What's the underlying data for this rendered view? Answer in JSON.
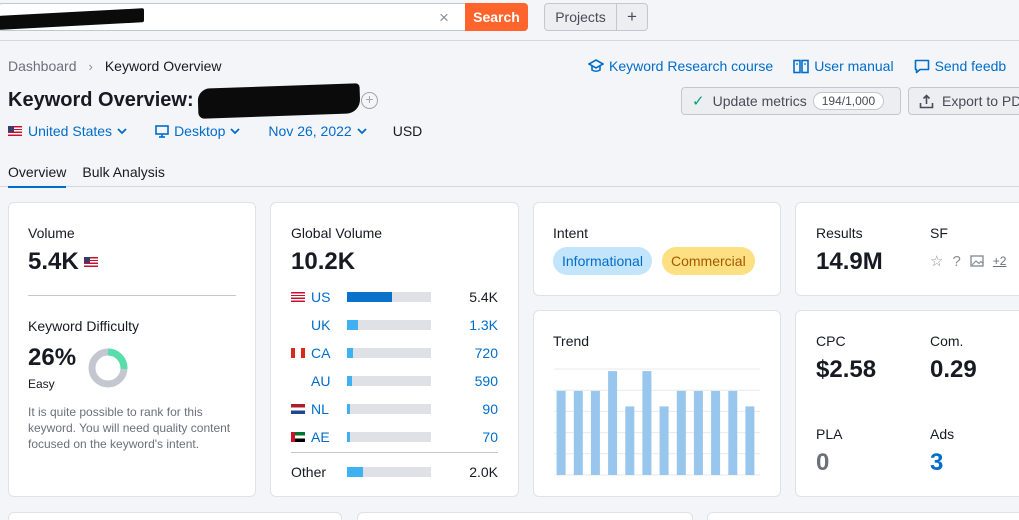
{
  "search": {
    "clear_symbol": "×",
    "button_label": "Search"
  },
  "projects": {
    "label": "Projects",
    "add_symbol": "+"
  },
  "breadcrumb": {
    "items": [
      "Dashboard",
      "Keyword Overview"
    ],
    "separator": "›"
  },
  "top_links": [
    {
      "label": "Keyword Research course",
      "icon": "graduation-cap-icon"
    },
    {
      "label": "User manual",
      "icon": "book-icon"
    },
    {
      "label": "Send feedb",
      "icon": "feedback-icon"
    }
  ],
  "header": {
    "title": "Keyword Overview:",
    "add_symbol": "+",
    "update_label": "Update metrics",
    "update_quota": "194/1,000",
    "export_label": "Export to PD"
  },
  "filters": {
    "country": "United States",
    "device": "Desktop",
    "date": "Nov 26, 2022",
    "currency": "USD"
  },
  "tabs": [
    "Overview",
    "Bulk Analysis"
  ],
  "volume_card": {
    "label": "Volume",
    "value": "5.4K",
    "kd_label": "Keyword Difficulty",
    "kd_value": "26%",
    "kd_percent": 26,
    "kd_level": "Easy",
    "kd_description": "It is quite possible to rank for this keyword. You will need quality content focused on the keyword's intent."
  },
  "global_volume": {
    "label": "Global Volume",
    "value": "10.2K",
    "rows": [
      {
        "code": "US",
        "value": "5.4K",
        "share": 0.53,
        "flag": "us"
      },
      {
        "code": "UK",
        "value": "1.3K",
        "share": 0.13,
        "flag": "uk"
      },
      {
        "code": "CA",
        "value": "720",
        "share": 0.07,
        "flag": "ca"
      },
      {
        "code": "AU",
        "value": "590",
        "share": 0.06,
        "flag": "au"
      },
      {
        "code": "NL",
        "value": "90",
        "share": 0.03,
        "flag": "nl"
      },
      {
        "code": "AE",
        "value": "70",
        "share": 0.02,
        "flag": "ae"
      },
      {
        "code": "Other",
        "value": "2.0K",
        "share": 0.19,
        "flag": ""
      }
    ]
  },
  "intent": {
    "label": "Intent",
    "badges": [
      "Informational",
      "Commercial"
    ]
  },
  "trend": {
    "label": "Trend"
  },
  "chart_data": {
    "type": "bar",
    "categories": [
      "1",
      "2",
      "3",
      "4",
      "5",
      "6",
      "7",
      "8",
      "9",
      "10",
      "11",
      "12"
    ],
    "values": [
      0.81,
      0.81,
      0.81,
      1.0,
      0.66,
      1.0,
      0.66,
      0.81,
      0.81,
      0.81,
      0.81,
      0.66
    ],
    "ylim": [
      0,
      1
    ],
    "grid": true,
    "color": "#98c6ec"
  },
  "results": {
    "label": "Results",
    "value": "14.9M",
    "sf_label": "SF",
    "sf_more": "+2"
  },
  "cpc": {
    "cpc_label": "CPC",
    "cpc_value": "$2.58",
    "com_label": "Com.",
    "com_value": "0.29",
    "pla_label": "PLA",
    "pla_value": "0",
    "ads_label": "Ads",
    "ads_value": "3"
  },
  "colors": {
    "accent": "#006dca",
    "search_button": "#ff642d",
    "bar_primary": "#0a72ca",
    "bar_secondary": "#3fb0f0",
    "kd_green": "#59ddaa"
  }
}
